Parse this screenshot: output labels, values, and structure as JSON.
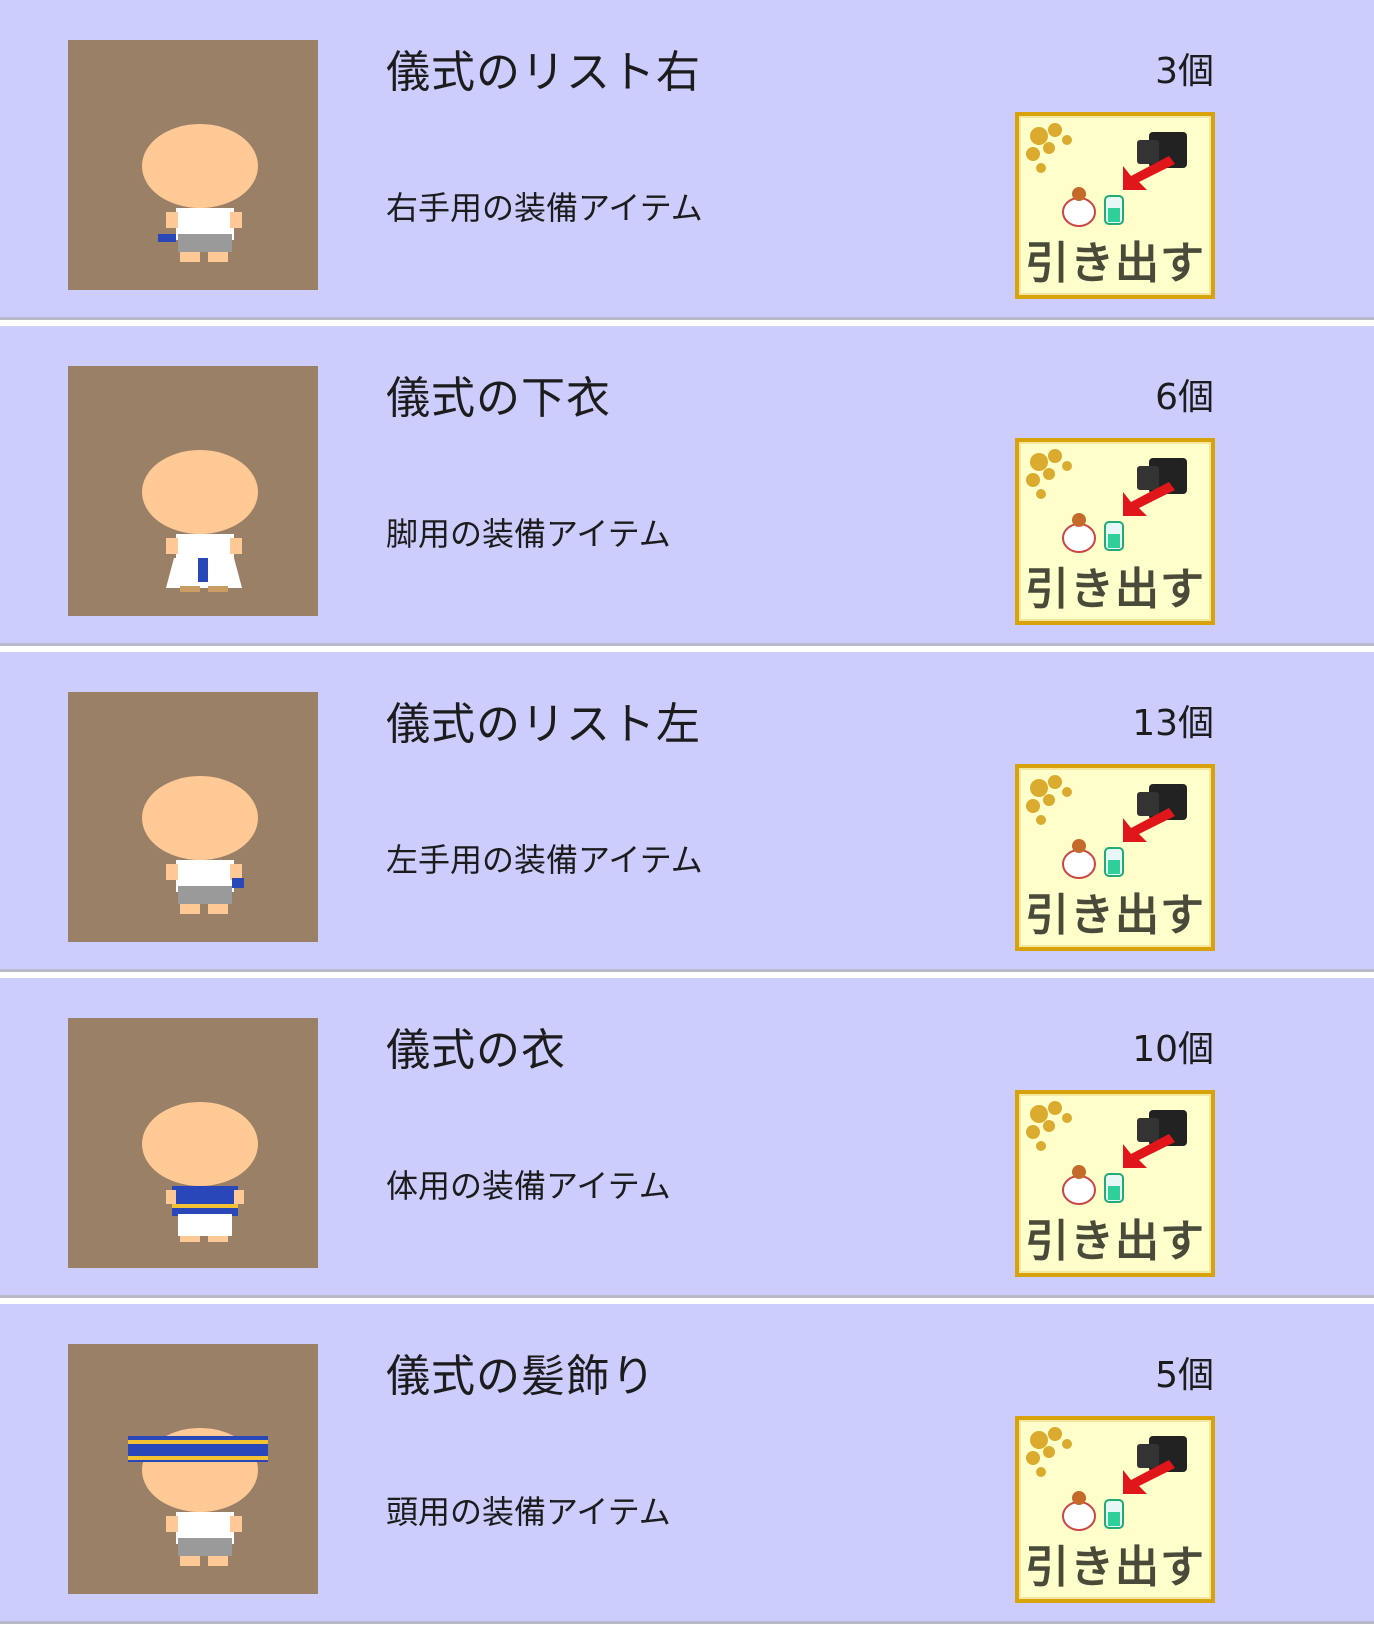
{
  "colors": {
    "row_background": "#ccccfd",
    "thumb_background": "#9a8067",
    "button_background": "#ffffcc",
    "button_border": "#d8a20c"
  },
  "items": [
    {
      "name": "儀式のリスト右",
      "description": "右手用の装備アイテム",
      "quantity": "3個",
      "accessory": "right-wristband",
      "withdraw_label": "引き出す"
    },
    {
      "name": "儀式の下衣",
      "description": "脚用の装備アイテム",
      "quantity": "6個",
      "accessory": "lower-garment",
      "withdraw_label": "引き出す"
    },
    {
      "name": "儀式のリスト左",
      "description": "左手用の装備アイテム",
      "quantity": "13個",
      "accessory": "left-wristband",
      "withdraw_label": "引き出す"
    },
    {
      "name": "儀式の衣",
      "description": "体用の装備アイテム",
      "quantity": "10個",
      "accessory": "body-garment",
      "withdraw_label": "引き出す"
    },
    {
      "name": "儀式の髪飾り",
      "description": "頭用の装備アイテム",
      "quantity": "5個",
      "accessory": "headband",
      "withdraw_label": "引き出す"
    }
  ]
}
